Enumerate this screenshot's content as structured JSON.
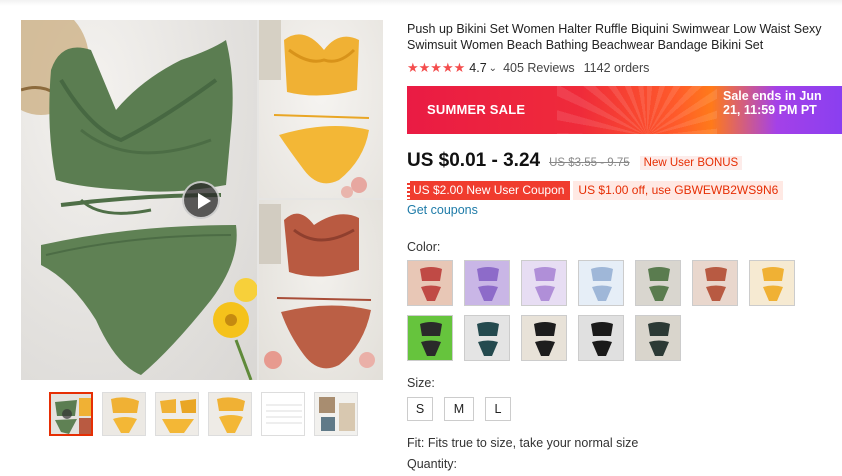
{
  "product": {
    "title": "Push up Bikini Set Women Halter Ruffle Biquini Swimwear Low Waist Sexy Swimsuit Women Beach Bathing Beachwear Bandage Bikini Set",
    "stars": "★★★★★",
    "rating": "4.7",
    "rating_chevron": "⌄",
    "reviews": "405 Reviews",
    "orders": "1142 orders"
  },
  "sale_banner": {
    "label": "SUMMER SALE",
    "ends": "Sale ends in Jun 21, 11:59 PM PT"
  },
  "price": {
    "current": "US $0.01 - 3.24",
    "original": "US $3.55 - 9.75",
    "bonus_badge": "New User BONUS"
  },
  "coupons": {
    "new_user": "US $2.00 New User Coupon",
    "code_offer": "US $1.00 off, use GBWEWB2WS9N6",
    "get_link": "Get coupons"
  },
  "color": {
    "label": "Color:",
    "options": [
      {
        "main": "#c04a45",
        "accent": "#e8c7b6"
      },
      {
        "main": "#8d6bc9",
        "accent": "#c9b6e6"
      },
      {
        "main": "#b08fd8",
        "accent": "#e7ddf3"
      },
      {
        "main": "#9fb7d8",
        "accent": "#e6eef7"
      },
      {
        "main": "#5a7c4f",
        "accent": "#d9d6cf"
      },
      {
        "main": "#b85a42",
        "accent": "#e9d7cd"
      },
      {
        "main": "#f0b134",
        "accent": "#f6ead2"
      },
      {
        "main": "#2a2a2a",
        "accent": "#66c43d"
      },
      {
        "main": "#244a4f",
        "accent": "#e4e4e4"
      },
      {
        "main": "#1d1d1d",
        "accent": "#e8e2d8"
      },
      {
        "main": "#1a1a1a",
        "accent": "#e0e0e0"
      },
      {
        "main": "#2c3a35",
        "accent": "#d9d5cc"
      }
    ]
  },
  "size": {
    "label": "Size:",
    "options": [
      "S",
      "M",
      "L"
    ]
  },
  "fit_text": "Fit: Fits true to size, take your normal size",
  "quantity_label": "Quantity:",
  "theme": {
    "accent_red": "#e62e04",
    "link_blue": "#1e7ba8",
    "star_color": "#f44d4d"
  }
}
